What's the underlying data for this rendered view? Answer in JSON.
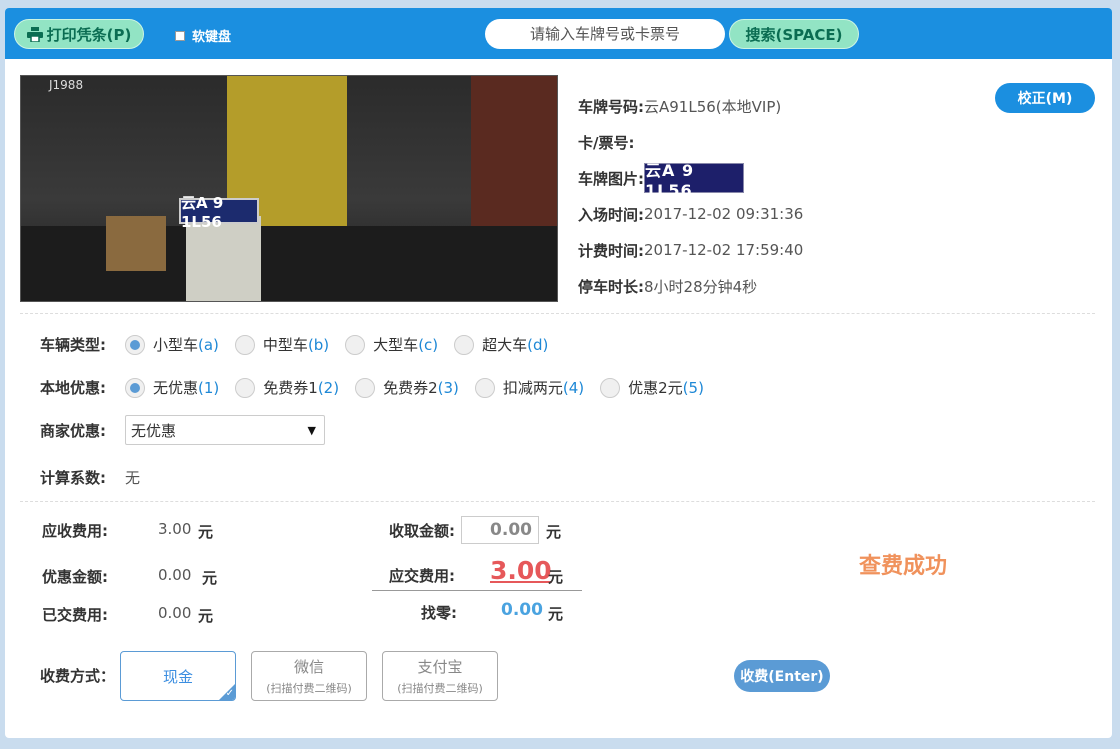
{
  "toolbar": {
    "print_label": "打印凭条(P)",
    "print_icon": "printer-icon",
    "soft_keyboard_label": "软键盘",
    "search_placeholder": "请输入车牌号或卡票号",
    "search_button_label": "搜索(SPACE)"
  },
  "vehicle": {
    "photo_plate_text": "云A 9 1L56",
    "photo_corner_text": "J1988",
    "fields": [
      {
        "label": "车牌号码:",
        "value": "云A91L56(本地VIP)"
      },
      {
        "label": "卡/票号:",
        "value": ""
      },
      {
        "label": "车牌图片:",
        "value": "云A 9 1L56"
      },
      {
        "label": "入场时间:",
        "value": "2017-12-02 09:31:36"
      },
      {
        "label": "计费时间:",
        "value": "2017-12-02 17:59:40"
      },
      {
        "label": "停车时长:",
        "value": "8小时28分钟4秒"
      }
    ],
    "correct_button_label": "校正(M)"
  },
  "options": {
    "vehicle_type": {
      "label": "车辆类型:",
      "items": [
        {
          "text": "小型车",
          "key": "(a)",
          "selected": true
        },
        {
          "text": "中型车",
          "key": "(b)",
          "selected": false
        },
        {
          "text": "大型车",
          "key": "(c)",
          "selected": false
        },
        {
          "text": "超大车",
          "key": "(d)",
          "selected": false
        }
      ]
    },
    "local_discount": {
      "label": "本地优惠:",
      "items": [
        {
          "text": "无优惠",
          "key": "(1)",
          "selected": true
        },
        {
          "text": "免费券1",
          "key": "(2)",
          "selected": false
        },
        {
          "text": "免费券2",
          "key": "(3)",
          "selected": false
        },
        {
          "text": "扣减两元",
          "key": "(4)",
          "selected": false
        },
        {
          "text": "优惠2元",
          "key": "(5)",
          "selected": false
        }
      ]
    },
    "merchant_discount": {
      "label": "商家优惠:",
      "selected": "无优惠"
    },
    "coefficient": {
      "label": "计算系数:",
      "value": "无"
    }
  },
  "fees": {
    "receivable_label": "应收费用:",
    "receivable_value": "3.00",
    "discount_label": "优惠金额:",
    "discount_value": "0.00",
    "paid_label": "已交费用:",
    "paid_value": "0.00",
    "collect_label": "收取金额:",
    "collect_value": "0.00",
    "due_label": "应交费用:",
    "due_value": "3.00",
    "change_label": "找零:",
    "change_value": "0.00",
    "unit": "元",
    "status": "查费成功"
  },
  "payment": {
    "label": "收费方式：",
    "methods": [
      {
        "text": "现金",
        "sub": "",
        "selected": true
      },
      {
        "text": "微信",
        "sub": "(扫描付费二维码)",
        "selected": false
      },
      {
        "text": "支付宝",
        "sub": "(扫描付费二维码)",
        "selected": false
      }
    ],
    "charge_button_label": "收费(Enter)"
  },
  "colors": {
    "primary": "#1b8fe0",
    "accent_green": "#92e4c4",
    "due_red": "#e6585a",
    "success_orange": "#f0925c"
  }
}
